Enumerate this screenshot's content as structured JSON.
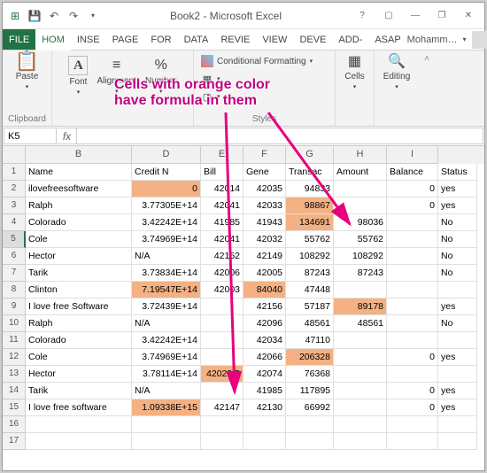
{
  "title": "Book2 - Microsoft Excel",
  "name_box": "K5",
  "user_name": "Mohamm…",
  "ribbon_tabs": [
    "FILE",
    "HOM",
    "INSE",
    "PAGE",
    "FOR",
    "DATA",
    "REVIE",
    "VIEW",
    "DEVE",
    "ADD-",
    "ASAP"
  ],
  "ribbon": {
    "paste": "Paste",
    "font": "Font",
    "alignment": "Alignment",
    "number": "Number",
    "cond_fmt_label": "Conditional Formatting",
    "cells": "Cells",
    "editing": "Editing",
    "group_clipboard": "Clipboard",
    "group_styles": "Styles"
  },
  "col_letters": [
    "B",
    "D",
    "E",
    "F",
    "G",
    "H",
    "I"
  ],
  "headers": {
    "B": "Name",
    "D": "Credit Number",
    "E": "Bill",
    "F": "Gender",
    "G": "Transactions",
    "H": "Amount",
    "I": "Balance",
    "J": "Status"
  },
  "rows": [
    {
      "n": 2,
      "B": "ilovefreesoftware",
      "D": "0",
      "E": "42014",
      "F": "42035",
      "G": "94833",
      "H": "",
      "I": "0",
      "J": "yes",
      "orange": [
        "D"
      ]
    },
    {
      "n": 3,
      "B": "Ralph",
      "D": "3.77305E+14",
      "E": "42041",
      "F": "42033",
      "G": "98867",
      "H": "",
      "I": "0",
      "J": "yes",
      "orange": [
        "G"
      ]
    },
    {
      "n": 4,
      "B": "Colorado",
      "D": "3.42242E+14",
      "E": "41985",
      "F": "41943",
      "G": "134691",
      "H": "98036",
      "I": "",
      "J": "No",
      "orange": [
        "G"
      ]
    },
    {
      "n": 5,
      "B": "Cole",
      "D": "3.74969E+14",
      "E": "42041",
      "F": "42032",
      "G": "55762",
      "H": "55762",
      "I": "",
      "J": "No",
      "orange": []
    },
    {
      "n": 6,
      "B": "Hector",
      "D": "N/A",
      "E": "42152",
      "F": "42149",
      "G": "108292",
      "H": "108292",
      "I": "",
      "J": "No",
      "orange": []
    },
    {
      "n": 7,
      "B": "Tarik",
      "D": "3.73834E+14",
      "E": "42006",
      "F": "42005",
      "G": "87243",
      "H": "87243",
      "I": "",
      "J": "No",
      "orange": []
    },
    {
      "n": 8,
      "B": "Clinton",
      "D": "7.19547E+14",
      "E": "42003",
      "F": "84040",
      "G": "47448",
      "H": "",
      "I": "",
      "J": "",
      "orange": [
        "D",
        "F"
      ]
    },
    {
      "n": 9,
      "B": "I love free Software",
      "D": "3.72439E+14",
      "E": "",
      "F": "42156",
      "G": "57187",
      "H": "89178",
      "I": "",
      "J": "yes",
      "orange": [
        "H"
      ]
    },
    {
      "n": 10,
      "B": "Ralph",
      "D": "N/A",
      "E": "",
      "F": "42096",
      "G": "48561",
      "H": "48561",
      "I": "",
      "J": "No",
      "orange": []
    },
    {
      "n": 11,
      "B": "Colorado",
      "D": "3.42242E+14",
      "E": "",
      "F": "42034",
      "G": "47110",
      "H": "",
      "I": "",
      "J": "",
      "orange": []
    },
    {
      "n": 12,
      "B": "Cole",
      "D": "3.74969E+14",
      "E": "",
      "F": "42066",
      "G": "206328",
      "H": "",
      "I": "0",
      "J": "yes",
      "orange": [
        "G"
      ]
    },
    {
      "n": 13,
      "B": "Hector",
      "D": "3.78114E+14",
      "E": "42023.5",
      "F": "42074",
      "G": "76368",
      "H": "",
      "I": "",
      "J": "",
      "orange": [
        "E"
      ]
    },
    {
      "n": 14,
      "B": "Tarik",
      "D": "N/A",
      "E": "",
      "F": "41985",
      "G": "117895",
      "H": "",
      "I": "0",
      "J": "yes",
      "orange": []
    },
    {
      "n": 15,
      "B": "I love free software",
      "D": "1.09338E+15",
      "E": "42147",
      "F": "42130",
      "G": "66992",
      "H": "",
      "I": "0",
      "J": "yes",
      "orange": [
        "D"
      ]
    }
  ],
  "empty_rows": [
    16,
    17
  ],
  "annotation": {
    "line1": "Cells with orange color",
    "line2": "have formula in them"
  }
}
